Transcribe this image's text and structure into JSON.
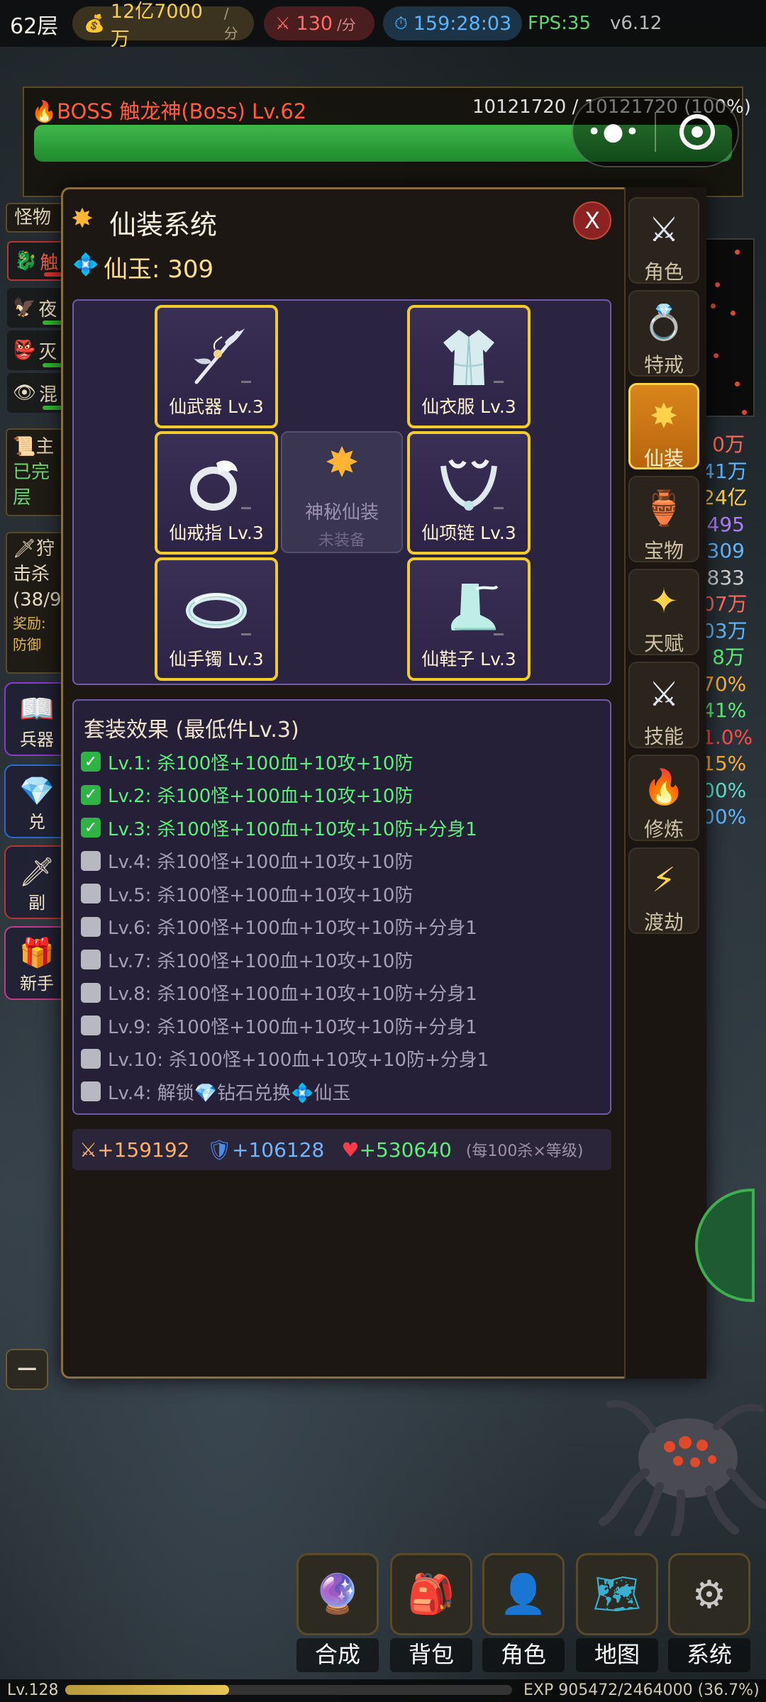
{
  "topbar": {
    "floor": "62层",
    "gold": "12亿7000万",
    "gold_unit": "/分",
    "kills": "130",
    "kills_unit": "/分",
    "timer": "159:28:03",
    "fps": "FPS:35",
    "version": "v6.12"
  },
  "boss": {
    "name": "BOSS 触龙神(Boss) Lv.62",
    "hp_text": "10121720 / 10121720  (100%)",
    "hp_fraction": 1.0
  },
  "background": {
    "left_tab": "怪物",
    "monsters": [
      "触",
      "夜",
      "灭",
      "混"
    ],
    "quest_title": "主",
    "quest_lines": [
      "已完",
      "层"
    ],
    "hunt_title": "狩",
    "hunt_lines": [
      "击杀",
      "(38/9",
      "奖励:",
      "防御"
    ],
    "side_buttons": [
      "兵器",
      "兑",
      "副",
      "新手"
    ],
    "right_values": [
      "0万",
      "41万",
      "24亿",
      "495",
      "309",
      "833",
      "07万",
      "03万",
      "8万",
      "70%",
      "41%",
      "1.0%",
      "15%",
      "00%",
      "00%"
    ],
    "minus": "−"
  },
  "modal": {
    "title": "仙装系统",
    "close": "X",
    "jade_label": "仙玉: 309",
    "slots": [
      {
        "name": "仙武器 Lv.3"
      },
      {
        "name": "仙衣服 Lv.3"
      },
      {
        "name": "仙戒指 Lv.3"
      },
      {
        "name": "仙项链 Lv.3"
      },
      {
        "name": "仙手镯 Lv.3"
      },
      {
        "name": "仙鞋子 Lv.3"
      }
    ],
    "mystery": {
      "name": "神秘仙装",
      "sub": "未装备"
    },
    "set_title": "套装效果 (最低件Lv.3)",
    "set_rows": [
      {
        "text": "Lv.1: 杀100怪+100血+10攻+10防",
        "on": true
      },
      {
        "text": "Lv.2: 杀100怪+100血+10攻+10防",
        "on": true
      },
      {
        "text": "Lv.3: 杀100怪+100血+10攻+10防+分身1",
        "on": true
      },
      {
        "text": "Lv.4: 杀100怪+100血+10攻+10防",
        "on": false
      },
      {
        "text": "Lv.5: 杀100怪+100血+10攻+10防",
        "on": false
      },
      {
        "text": "Lv.6: 杀100怪+100血+10攻+10防+分身1",
        "on": false
      },
      {
        "text": "Lv.7: 杀100怪+100血+10攻+10防",
        "on": false
      },
      {
        "text": "Lv.8: 杀100怪+100血+10攻+10防+分身1",
        "on": false
      },
      {
        "text": "Lv.9: 杀100怪+100血+10攻+10防+分身1",
        "on": false
      },
      {
        "text": "Lv.10: 杀100怪+100血+10攻+10防+分身1",
        "on": false
      },
      {
        "text": "Lv.4: 解锁💎钻石兑换💠仙玉",
        "on": false
      }
    ],
    "stats": {
      "atk": "+159192",
      "def": "+106128",
      "hp": "+530640",
      "note": "(每100杀×等级)"
    }
  },
  "tabs": [
    {
      "label": "角色",
      "icon": "crossed-swords-icon",
      "active": false
    },
    {
      "label": "特戒",
      "icon": "ring-icon",
      "active": false
    },
    {
      "label": "仙装",
      "icon": "sun-icon",
      "active": true
    },
    {
      "label": "宝物",
      "icon": "vase-icon",
      "active": false
    },
    {
      "label": "天赋",
      "icon": "sparkle-icon",
      "active": false
    },
    {
      "label": "技能",
      "icon": "crossed-swords-icon",
      "active": false
    },
    {
      "label": "修炼",
      "icon": "fire-icon",
      "active": false
    },
    {
      "label": "渡劫",
      "icon": "lightning-icon",
      "active": false
    }
  ],
  "dock": [
    {
      "label": "合成",
      "icon": "crystal-ball-icon"
    },
    {
      "label": "背包",
      "icon": "backpack-icon"
    },
    {
      "label": "角色",
      "icon": "person-icon"
    },
    {
      "label": "地图",
      "icon": "map-icon"
    },
    {
      "label": "系统",
      "icon": "gear-icon"
    }
  ],
  "footer": {
    "level": "Lv.128",
    "exp": "EXP 905472/2464000 (36.7%)",
    "exp_fraction": 0.367
  },
  "colors": {
    "accent_gold": "#f2cc2a",
    "active_tab": "#d9861c",
    "set_on": "#5cf07a",
    "set_off": "#a59fb3",
    "hp_green": "#2fa23e"
  }
}
